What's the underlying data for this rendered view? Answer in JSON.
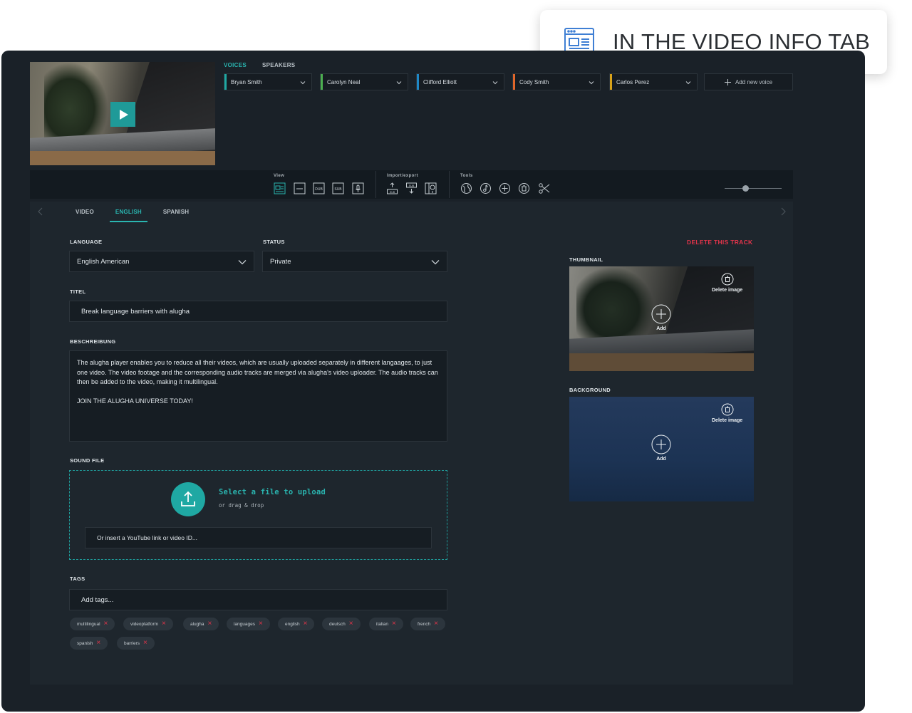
{
  "callout": {
    "text": "IN THE VIDEO INFO TAB",
    "icon": "browser-window-icon"
  },
  "colors": {
    "accent": "#2ab5b0",
    "danger": "#e0344a",
    "panel": "#1e262d",
    "frame": "#1a2128"
  },
  "voices": {
    "tabs": [
      {
        "label": "VOICES",
        "active": true
      },
      {
        "label": "SPEAKERS",
        "active": false
      }
    ],
    "items": [
      {
        "name": "Bryan Smith",
        "color": "#1fa8a3"
      },
      {
        "name": "Carolyn Neal",
        "color": "#4caf50"
      },
      {
        "name": "Clifford Elliott",
        "color": "#1e88c7"
      },
      {
        "name": "Cody Smith",
        "color": "#e0662a"
      },
      {
        "name": "Carlos Perez",
        "color": "#d8a21a"
      }
    ],
    "add_label": "Add new voice"
  },
  "toolbar": {
    "view_label": "View",
    "import_export_label": "Import/export",
    "tools_label": "Tools",
    "view_icons": [
      "video-info-icon",
      "timeline-icon",
      "dub-icon",
      "sub-icon",
      "microphone-icon"
    ],
    "import_icons": [
      "import-sub-icon",
      "export-sub-icon",
      "export-video-icon"
    ],
    "tool_icons": [
      "translate-globe-icon",
      "audio-note-icon",
      "add-circle-icon",
      "delete-circle-icon",
      "scissors-icon"
    ]
  },
  "tabs": [
    {
      "label": "VIDEO",
      "active": false
    },
    {
      "label": "ENGLISH",
      "active": true
    },
    {
      "label": "SPANISH",
      "active": false
    }
  ],
  "form": {
    "language_label": "LANGUAGE",
    "language_value": "English American",
    "status_label": "STATUS",
    "status_value": "Private",
    "title_label": "TITEL",
    "title_value": "Break language barriers with alugha",
    "description_label": "BESCHREIBUNG",
    "description_p1": "The alugha player enables you to reduce all their videos, which are usually uploaded separately in different langaages, to just one video. The video footage and the corresponding audio tracks are merged via alugha's video uploader. The audio tracks can then be added to the video, making it multilingual.",
    "description_p2": "JOIN THE ALUGHA UNIVERSE TODAY!",
    "sound_label": "SOUND FILE",
    "upload_title": "Select a file to upload",
    "upload_sub": "or drag & drop",
    "youtube_placeholder": "Or insert a YouTube link or video ID...",
    "tags_label": "TAGS",
    "tags_placeholder": "Add tags...",
    "tags": [
      "multilingual",
      "videoplatform",
      "alugha",
      "languages",
      "english",
      "deutsch",
      "italian",
      "french",
      "spanish",
      "barriers"
    ]
  },
  "right": {
    "delete_track": "DELETE THIS TRACK",
    "thumbnail_label": "THUMBNAIL",
    "background_label": "BACKGROUND",
    "delete_image": "Delete image",
    "add": "Add"
  }
}
